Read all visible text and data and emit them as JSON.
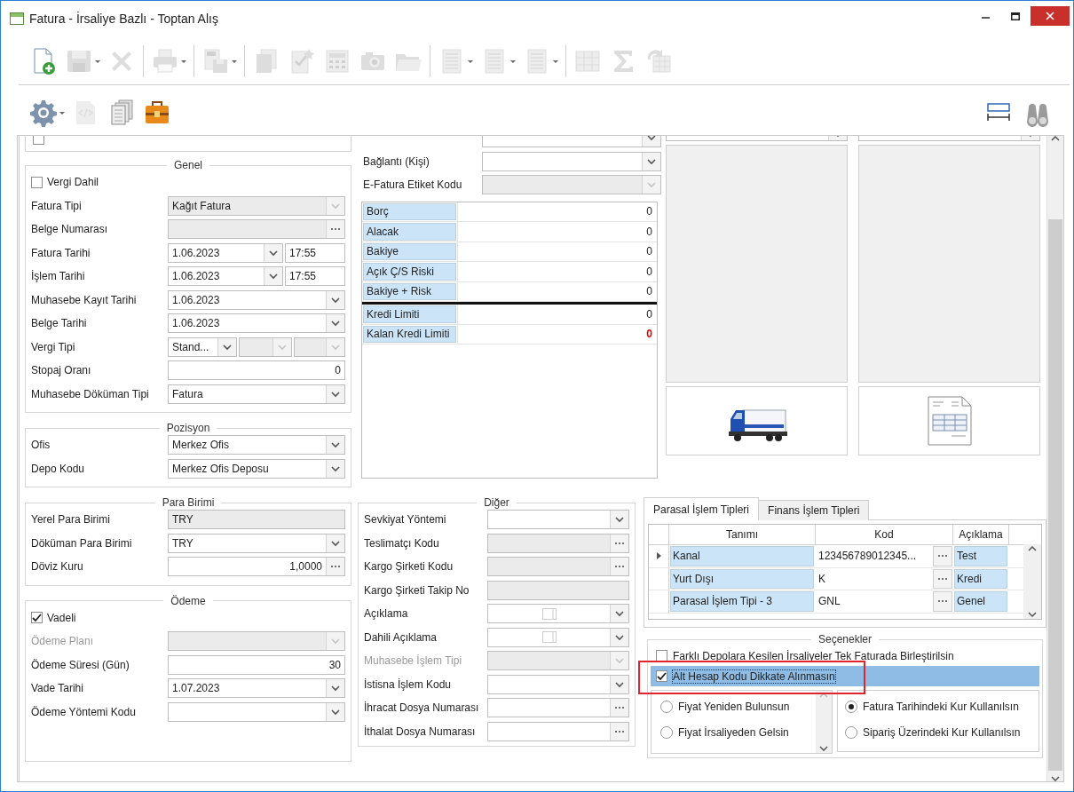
{
  "window": {
    "title": "Fatura - İrsaliye Bazlı - Toptan Alış"
  },
  "toolbar": {
    "rows": [
      [
        {
          "kind": "button",
          "disabled": false
        },
        {
          "kind": "button",
          "disabled": true,
          "dropdown": true
        },
        {
          "kind": "button",
          "disabled": true
        },
        {
          "kind": "separator"
        },
        {
          "kind": "button",
          "disabled": true,
          "dropdown": true
        },
        {
          "kind": "separator"
        },
        {
          "kind": "button",
          "disabled": true,
          "dropdown": true
        },
        {
          "kind": "separator"
        },
        {
          "kind": "button",
          "disabled": true
        },
        {
          "kind": "button",
          "disabled": true
        },
        {
          "kind": "button",
          "disabled": true
        },
        {
          "kind": "button",
          "disabled": true
        },
        {
          "kind": "button",
          "disabled": true
        },
        {
          "kind": "separator"
        },
        {
          "kind": "button",
          "disabled": true,
          "dropdown": true
        },
        {
          "kind": "button",
          "disabled": true,
          "dropdown": true
        },
        {
          "kind": "button",
          "disabled": true,
          "dropdown": true
        },
        {
          "kind": "separator"
        },
        {
          "kind": "button",
          "disabled": true
        },
        {
          "kind": "button",
          "disabled": true
        },
        {
          "kind": "button",
          "disabled": true
        }
      ],
      [
        {
          "kind": "button",
          "disabled": false,
          "dropdown": true
        },
        {
          "kind": "button",
          "disabled": true
        },
        {
          "kind": "button",
          "disabled": false
        },
        {
          "kind": "button",
          "disabled": false
        }
      ]
    ],
    "right": [
      {
        "kind": "button",
        "disabled": false
      },
      {
        "kind": "button",
        "disabled": false
      }
    ]
  },
  "left_top": [
    {
      "rows": [
        {
          "kind": "checkbox",
          "checked": false
        }
      ]
    },
    {
      "title": "Genel",
      "rows": [
        {
          "kind": "checkbox",
          "label": "Vergi Dahil",
          "checked": false
        },
        {
          "kind": "combo",
          "label": "Fatura Tipi",
          "value": "Kağıt Fatura",
          "readonly": true
        },
        {
          "kind": "ellipsis",
          "label": "Belge Numarası",
          "readonly": true
        },
        {
          "kind": "datetime",
          "label": "Fatura Tarihi",
          "value": "1.06.2023",
          "time": "17:55"
        },
        {
          "kind": "datetime",
          "label": "İşlem Tarihi",
          "value": "1.06.2023",
          "time": "17:55"
        },
        {
          "kind": "combo",
          "label": "Muhasebe Kayıt Tarihi",
          "value": "1.06.2023"
        },
        {
          "kind": "combo",
          "label": "Belge Tarihi",
          "value": "1.06.2023"
        },
        {
          "kind": "triple",
          "label": "Vergi Tipi",
          "parts": [
            {
              "value": "Stand...",
              "readonly": false
            },
            {
              "readonly": true
            },
            {
              "readonly": true
            }
          ]
        },
        {
          "kind": "number",
          "label": "Stopaj Oranı",
          "value": "0"
        },
        {
          "kind": "combo",
          "label": "Muhasebe Döküman Tipi",
          "value": "Fatura"
        }
      ]
    },
    {
      "title": "Pozisyon",
      "rows": [
        {
          "kind": "combo",
          "label": "Ofis",
          "value": "Merkez Ofis"
        },
        {
          "kind": "combo",
          "label": "Depo Kodu",
          "value": "Merkez Ofis Deposu"
        }
      ]
    }
  ],
  "left_bottom": [
    {
      "title": "Para Birimi",
      "rows": [
        {
          "kind": "text",
          "label": "Yerel Para Birimi",
          "value": "TRY",
          "readonly": true
        },
        {
          "kind": "combo",
          "label": "Döküman Para Birimi",
          "value": "TRY"
        },
        {
          "kind": "number-ellipsis",
          "label": "Döviz Kuru",
          "value": "1,0000"
        }
      ]
    },
    {
      "title": "Ödeme",
      "rows": [
        {
          "kind": "checkbox",
          "label": "Vadeli",
          "checked": true
        },
        {
          "kind": "combo",
          "label": "Ödeme Planı",
          "disabled": true
        },
        {
          "kind": "number",
          "label": "Ödeme Süresi (Gün)",
          "value": "30"
        },
        {
          "kind": "combo",
          "label": "Vade Tarihi",
          "value": "1.07.2023"
        },
        {
          "kind": "combo",
          "label": "Ödeme Yöntemi Kodu"
        }
      ]
    }
  ],
  "middle_top": {
    "rows": [
      {
        "kind": "combo"
      },
      {
        "kind": "combo",
        "label": "Bağlantı (Kişi)"
      },
      {
        "kind": "combo",
        "label": "E-Fatura Etiket Kodu",
        "readonly": true
      }
    ],
    "balances": [
      {
        "label": "Borç",
        "value": "0",
        "divider_above": false,
        "alert": false
      },
      {
        "label": "Alacak",
        "value": "0",
        "divider_above": false,
        "alert": false
      },
      {
        "label": "Bakiye",
        "value": "0",
        "divider_above": false,
        "alert": false
      },
      {
        "label": "Açık Ç/S Riski",
        "value": "0",
        "divider_above": false,
        "alert": false
      },
      {
        "label": "Bakiye + Risk",
        "value": "0",
        "divider_above": false,
        "alert": false
      },
      {
        "label": "Kredi Limiti",
        "value": "0",
        "divider_above": true,
        "alert": false
      },
      {
        "label": "Kalan Kredi Limiti",
        "value": "0",
        "divider_above": false,
        "alert": true
      }
    ]
  },
  "middle_bottom": {
    "title": "Diğer",
    "rows": [
      {
        "kind": "combo",
        "label": "Sevkiyat Yöntemi"
      },
      {
        "kind": "ellipsis",
        "label": "Teslimatçı Kodu",
        "readonly": true
      },
      {
        "kind": "ellipsis",
        "label": "Kargo Şirketi Kodu",
        "readonly": true
      },
      {
        "kind": "text",
        "label": "Kargo Şirketi Takip No",
        "readonly": true
      },
      {
        "kind": "memo",
        "label": "Açıklama"
      },
      {
        "kind": "memo",
        "label": "Dahili Açıklama"
      },
      {
        "kind": "combo",
        "label": "Muhasebe İşlem Tipi",
        "disabled": true
      },
      {
        "kind": "combo",
        "label": "İstisna İşlem Kodu"
      },
      {
        "kind": "ellipsis",
        "label": "İhracat Dosya Numarası"
      },
      {
        "kind": "ellipsis",
        "label": "İthalat Dosya Numarası"
      }
    ]
  },
  "right_bottom": {
    "tabs": [
      {
        "label": "Parasal İşlem Tipleri",
        "selected": true
      },
      {
        "label": "Finans İşlem Tipleri",
        "selected": false
      }
    ],
    "grid": {
      "columns": [
        "Tanımı",
        "Kod",
        "Açıklama"
      ],
      "rows": [
        {
          "cells": [
            "Kanal",
            "123456789012345...",
            "Test"
          ],
          "current": true
        },
        {
          "cells": [
            "Yurt Dışı",
            "K",
            "Kredi"
          ],
          "current": false
        },
        {
          "cells": [
            "Parasal İşlem Tipi - 3",
            "GNL",
            "Genel"
          ],
          "current": false
        }
      ]
    },
    "options": {
      "title": "Seçenekler",
      "checks": [
        {
          "label": "Farklı Depolara Kesilen İrsaliyeler Tek Faturada Birleştirilsin",
          "checked": false,
          "focused": false,
          "annotated": false
        },
        {
          "label": "Alt Hesap Kodu Dikkate Alınmasın",
          "checked": true,
          "focused": true,
          "annotated": true
        }
      ],
      "radios_left": [
        {
          "label": "Fiyat Yeniden Bulunsun",
          "selected": false
        },
        {
          "label": "Fiyat İrsaliyeden Gelsin",
          "selected": false
        }
      ],
      "radios_right": [
        {
          "label": "Fatura Tarihindeki Kur Kullanılsın",
          "selected": true
        },
        {
          "label": "Sipariş Üzerindeki Kur Kullanılsın",
          "selected": false
        }
      ]
    }
  }
}
